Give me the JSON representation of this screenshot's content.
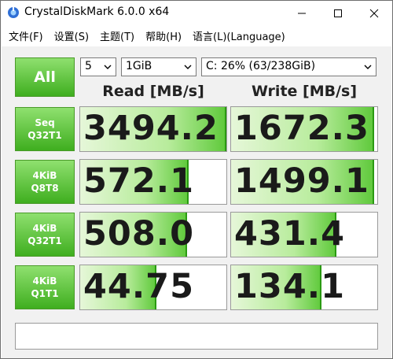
{
  "window": {
    "title": "CrystalDiskMark 6.0.0 x64"
  },
  "menu": [
    {
      "label": "文件(F)"
    },
    {
      "label": "设置(S)"
    },
    {
      "label": "主题(T)"
    },
    {
      "label": "帮助(H)"
    },
    {
      "label": "语言(L)(Language)"
    }
  ],
  "controls": {
    "all_label": "All",
    "test_count": "5",
    "test_size": "1GiB",
    "drive": "C: 26% (63/238GiB)"
  },
  "headers": {
    "read": "Read [MB/s]",
    "write": "Write [MB/s]"
  },
  "tests": [
    {
      "line1": "Seq",
      "line2": "Q32T1",
      "read": "3494.2",
      "write": "1672.3",
      "read_fill": 1.0,
      "write_fill": 0.98
    },
    {
      "line1": "4KiB",
      "line2": "Q8T8",
      "read": "572.1",
      "write": "1499.1",
      "read_fill": 0.74,
      "write_fill": 0.98
    },
    {
      "line1": "4KiB",
      "line2": "Q32T1",
      "read": "508.0",
      "write": "431.4",
      "read_fill": 0.73,
      "write_fill": 0.72
    },
    {
      "line1": "4KiB",
      "line2": "Q1T1",
      "read": "44.75",
      "write": "134.1",
      "read_fill": 0.52,
      "write_fill": 0.62
    }
  ],
  "comment": "",
  "colors": {
    "button_green": "#3fae1f",
    "bar_green": "#5ec93a",
    "panel_bg": "#f1f1f1"
  },
  "icons": {
    "app": "crystaldiskmark-app-icon",
    "minimize": "minimize-icon",
    "maximize": "maximize-icon",
    "close": "close-icon",
    "dropdown": "chevron-down-icon"
  }
}
